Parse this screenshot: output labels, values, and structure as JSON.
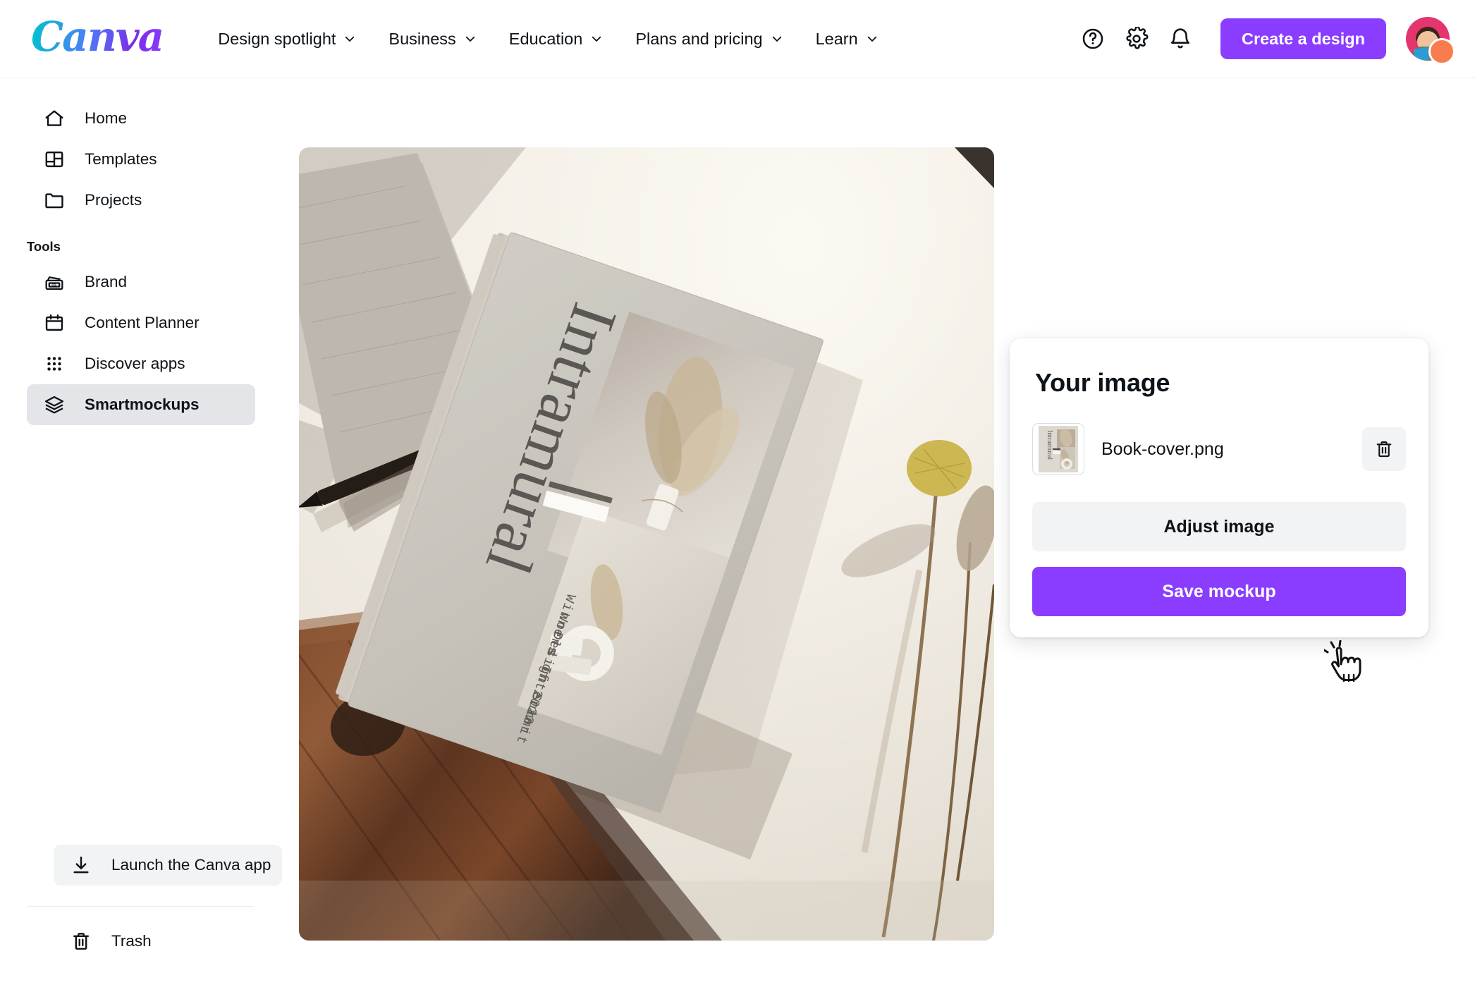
{
  "header": {
    "logo_text": "Canva",
    "nav": [
      {
        "label": "Design spotlight",
        "has_caret": true
      },
      {
        "label": "Business",
        "has_caret": true
      },
      {
        "label": "Education",
        "has_caret": true
      },
      {
        "label": "Plans and pricing",
        "has_caret": true
      },
      {
        "label": "Learn",
        "has_caret": true
      }
    ],
    "icons": [
      {
        "name": "help-icon",
        "glyph": "?"
      },
      {
        "name": "gear-icon",
        "glyph": "gear"
      },
      {
        "name": "bell-icon",
        "glyph": "bell"
      }
    ],
    "create_button": "Create a design",
    "accent_color": "#8b3dff",
    "avatar_ring_color": "#e3356e",
    "avatar_badge_color": "#f97c4f"
  },
  "sidebar": {
    "primary": [
      {
        "label": "Home",
        "icon": "home-icon",
        "active": false
      },
      {
        "label": "Templates",
        "icon": "templates-icon",
        "active": false
      },
      {
        "label": "Projects",
        "icon": "folder-icon",
        "active": false
      }
    ],
    "section_label": "Tools",
    "tools": [
      {
        "label": "Brand",
        "icon": "brand-icon",
        "active": false
      },
      {
        "label": "Content Planner",
        "icon": "calendar-icon",
        "active": false
      },
      {
        "label": "Discover apps",
        "icon": "grid-apps-icon",
        "active": false
      },
      {
        "label": "Smartmockups",
        "icon": "layers-icon",
        "active": true
      }
    ],
    "launch_app": {
      "label": "Launch the Canva app",
      "icon": "download-icon"
    },
    "trash": {
      "label": "Trash",
      "icon": "trash-icon"
    },
    "active_bg": "#e3e5e9"
  },
  "mockup": {
    "alt": "Book mockup flat lay on beige desk with wooden tray, pencil, notebook and dried flowers",
    "book_title": "Intramural",
    "book_subtitle_lines": [
      "Winners of 2022",
      "World Interior",
      "Design Summit"
    ]
  },
  "panel": {
    "title": "Your image",
    "file": {
      "name": "Book-cover.png",
      "thumbnail_alt": "Intramural book cover thumbnail"
    },
    "delete_label": "Delete",
    "adjust_label": "Adjust image",
    "save_label": "Save mockup",
    "save_color": "#8b3dff",
    "secondary_bg": "#f2f3f5"
  },
  "cursor": {
    "type": "pointing-hand-click"
  }
}
